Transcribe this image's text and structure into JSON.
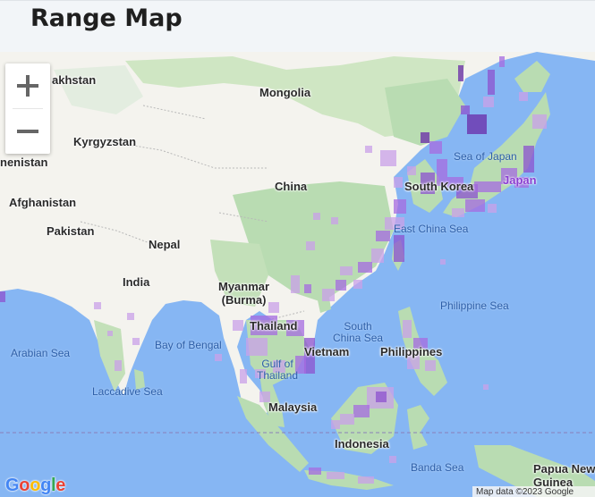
{
  "header": {
    "title": "Range Map"
  },
  "map": {
    "zoom_in_label": "+",
    "zoom_out_label": "−",
    "country_labels": {
      "kazakhstan": "akhstan",
      "mongolia": "Mongolia",
      "kyrgyzstan": "Kyrgyzstan",
      "turkmenistan": "nenistan",
      "afghanistan": "Afghanistan",
      "china": "China",
      "south_korea": "South Korea",
      "japan": "Japan",
      "pakistan": "Pakistan",
      "nepal": "Nepal",
      "india": "India",
      "myanmar": "Myanmar\n(Burma)",
      "thailand": "Thailand",
      "vietnam": "Vietnam",
      "philippines": "Philippines",
      "malaysia": "Malaysia",
      "indonesia": "Indonesia",
      "papua": "Papua New\nGuinea"
    },
    "sea_labels": {
      "sea_of_japan": "Sea of Japan",
      "east_china_sea": "East China Sea",
      "philippine_sea": "Philippine Sea",
      "south_china_sea": "South\nChina Sea",
      "bay_of_bengal": "Bay of Bengal",
      "arabian_sea": "Arabian Sea",
      "gulf_of_thailand": "Gulf of\nThailand",
      "laccadive_sea": "Laccadive Sea",
      "banda_sea": "Banda Sea"
    },
    "attribution": "Map data ©2023 Google",
    "google_logo": {
      "g1": "G",
      "o1": "o",
      "o2": "o",
      "g2": "g",
      "l": "l",
      "e": "e"
    },
    "colors": {
      "water": "#86b6f3",
      "land": "#f4f3ee",
      "forest": "#b9dcb2",
      "range_light": "#c9a0e8",
      "range_mid": "#a66be0",
      "range_dark": "#6a2aa8"
    }
  }
}
